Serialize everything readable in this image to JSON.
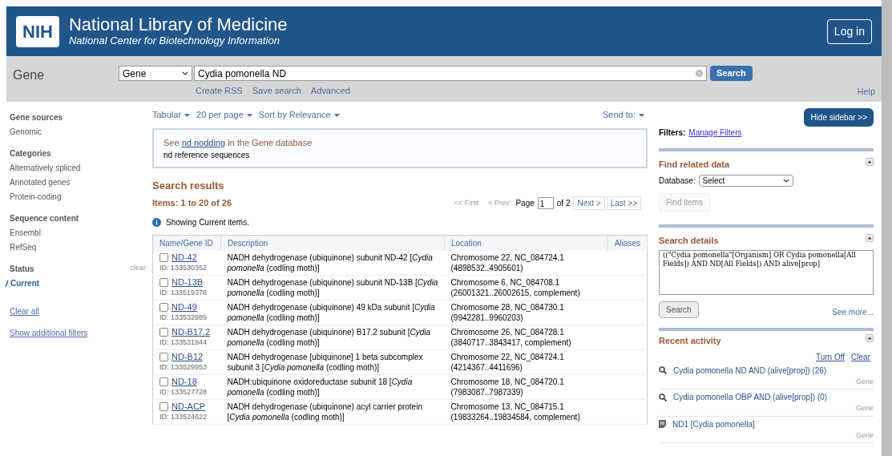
{
  "header": {
    "logo": "NIH",
    "title": "National Library of Medicine",
    "subtitle": "National Center for Biotechnology Information",
    "login": "Log in"
  },
  "searchbar": {
    "db_label": "Gene",
    "db_select": "Gene",
    "query": "Cydia pomonella ND",
    "links": [
      "Create RSS",
      "Save search",
      "Advanced"
    ],
    "search": "Search",
    "help": "Help"
  },
  "filters": [
    {
      "title": "Gene sources",
      "items": [
        {
          "label": "Genomic",
          "selected": false
        }
      ]
    },
    {
      "title": "Categories",
      "items": [
        {
          "label": "Alternatively spliced",
          "selected": false
        },
        {
          "label": "Annotated genes",
          "selected": false
        },
        {
          "label": "Protein-coding",
          "selected": false
        }
      ]
    },
    {
      "title": "Sequence content",
      "items": [
        {
          "label": "Ensembl",
          "selected": false
        },
        {
          "label": "RefSeq",
          "selected": false
        }
      ]
    },
    {
      "title": "Status",
      "clear": "clear",
      "items": [
        {
          "label": "Current",
          "selected": true
        }
      ]
    }
  ],
  "filter_links": [
    "Clear all",
    "Show additional filters"
  ],
  "toolbar": {
    "format": "Tabular",
    "per_page": "20 per page",
    "sort": "Sort by Relevance",
    "send_to": "Send to:"
  },
  "suggestion": {
    "prefix": "See ",
    "link": "nd nodding",
    "suffix": " in the Gene database",
    "line2": "nd reference sequences"
  },
  "results": {
    "title": "Search results",
    "items": "Items: 1 to 20 of 26",
    "first": "<< First",
    "prev": "< Prev",
    "page_label": "Page",
    "page": "1",
    "of": "of 2",
    "next": "Next >",
    "last": "Last >>",
    "notice": "Showing Current items."
  },
  "table": {
    "columns": [
      "Name/Gene ID",
      "Description",
      "Location",
      "Aliases"
    ],
    "rows": [
      {
        "checked": false,
        "name": "ND-42",
        "id": "ID: 133530352",
        "description": "NADH dehydrogenase (ubiquinone) subunit ND-42 [*Cydia pomonella* (codling moth)]",
        "location": "Chromosome 22, NC_084724.1 (4898532..4905601)"
      },
      {
        "checked": false,
        "name": "ND-13B",
        "id": "ID: 133519378",
        "description": "NADH dehydrogenase (ubiquinone) subunit ND-13B [*Cydia pomonella* (codling moth)]",
        "location": "Chromosome 6, NC_084708.1 (26001321..26002615, complement)"
      },
      {
        "checked": false,
        "name": "ND-49",
        "id": "ID: 133532989",
        "description": "NADH dehydrogenase (ubiquinone) 49 kDa subunit [*Cydia pomonella* (codling moth)]",
        "location": "Chromosome 28, NC_084730.1 (9942281..9960203)"
      },
      {
        "checked": false,
        "name": "ND-B17.2",
        "id": "ID: 133531944",
        "description": "NADH dehydrogenase (ubiquinone) B17.2 subunit [*Cydia pomonella* (codling moth)]",
        "location": "Chromosome 26, NC_084728.1 (3840717..3843417, complement)"
      },
      {
        "checked": false,
        "name": "ND-B12",
        "id": "ID: 133529953",
        "description": "NADH dehydrogenase [ubiquinone] 1 beta subcomplex subunit 3 [*Cydia pomonella* (codling moth)]",
        "location": "Chromosome 22, NC_084724.1 (4214367..4411696)"
      },
      {
        "checked": false,
        "name": "ND-18",
        "id": "ID: 133527728",
        "description": "NADH:ubiquinone oxidoreductase subunit 18 [*Cydia pomonella* (codling moth)]",
        "location": "Chromosome 18, NC_084720.1 (7983087..7987339)"
      },
      {
        "checked": false,
        "name": "ND-ACP",
        "id": "ID: 133524622",
        "description": "NADH dehydrogenase (ubiquinone) acyl carrier protein [*Cydia pomonella* (codling moth)]",
        "location": "Chromosome 13, NC_084715.1 (19833264..19834584, complement)"
      }
    ]
  },
  "sidebar": {
    "hide": "Hide sidebar >>",
    "filters_label": "Filters:",
    "manage": "Manage Filters",
    "related": {
      "title": "Find related data",
      "db_label": "Database:",
      "db_select": "Select",
      "find": "Find items"
    },
    "details": {
      "title": "Search details",
      "query": "((\"Cydia pomonella\"[Organism] OR Cydia pomonella[All Fields]) AND ND[All Fields]) AND alive[prop]",
      "search": "Search",
      "more": "See more..."
    },
    "recent": {
      "title": "Recent activity",
      "turn_off": "Turn Off",
      "clear": "Clear",
      "items": [
        {
          "kind": "search",
          "text": "Cydia pomonella ND AND (alive[prop]) (26)",
          "db": "Gene"
        },
        {
          "kind": "search",
          "text": "Cydia pomonella OBP AND (alive[prop]) (0)",
          "db": "Gene"
        },
        {
          "kind": "record",
          "text": "ND1 [Cydia pomonella]",
          "db": "Gene"
        }
      ]
    }
  }
}
